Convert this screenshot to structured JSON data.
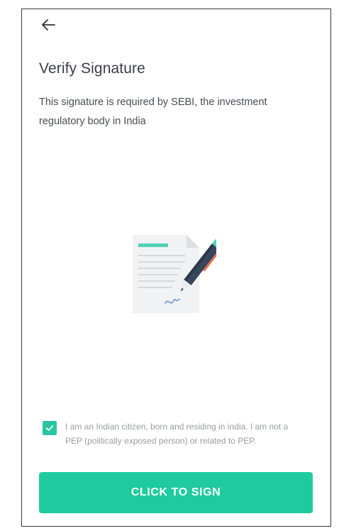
{
  "header": {
    "back_icon": "arrow-left-icon"
  },
  "page": {
    "title": "Verify Signature",
    "description": "This signature is required by SEBI, the investment regulatory body in India"
  },
  "illustration": {
    "icon": "document-signing-pen-icon"
  },
  "consent": {
    "checked": true,
    "text": "I am an Indian citizen, born and residing in india. I am not a PEP (politically exposed person) or related to PEP."
  },
  "cta": {
    "label": "CLICK TO SIGN"
  },
  "colors": {
    "accent": "#1fcb9e",
    "title_text": "#3b3e48",
    "muted_text": "#9a9ca3"
  }
}
